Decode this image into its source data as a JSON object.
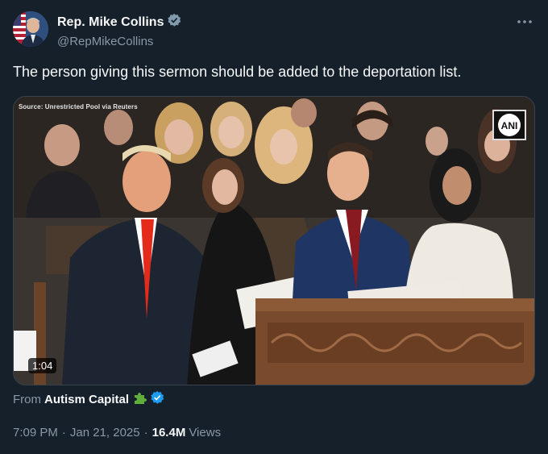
{
  "author": {
    "display_name": "Rep. Mike Collins",
    "handle": "@RepMikeCollins",
    "verified_color": "#829aab"
  },
  "tweet": {
    "text": "The person giving this sermon should be added to the deportation list."
  },
  "media": {
    "source_label": "Source: Unrestricted Pool via Reuters",
    "watermark": "ANI",
    "duration": "1:04"
  },
  "attribution": {
    "from_label": "From",
    "from_name": "Autism Capital",
    "emoji": "puzzle-piece-icon",
    "verified_color": "#1d9bf0"
  },
  "meta": {
    "time": "7:09 PM",
    "date": "Jan 21, 2025",
    "views_count": "16.4M",
    "views_label": "Views"
  },
  "icons": [
    "more-icon",
    "verified-badge-icon",
    "play-duration"
  ],
  "colors": {
    "background": "#15202b",
    "text_primary": "#f7f9f9",
    "text_secondary": "#8b98a5",
    "border": "#38444d"
  }
}
